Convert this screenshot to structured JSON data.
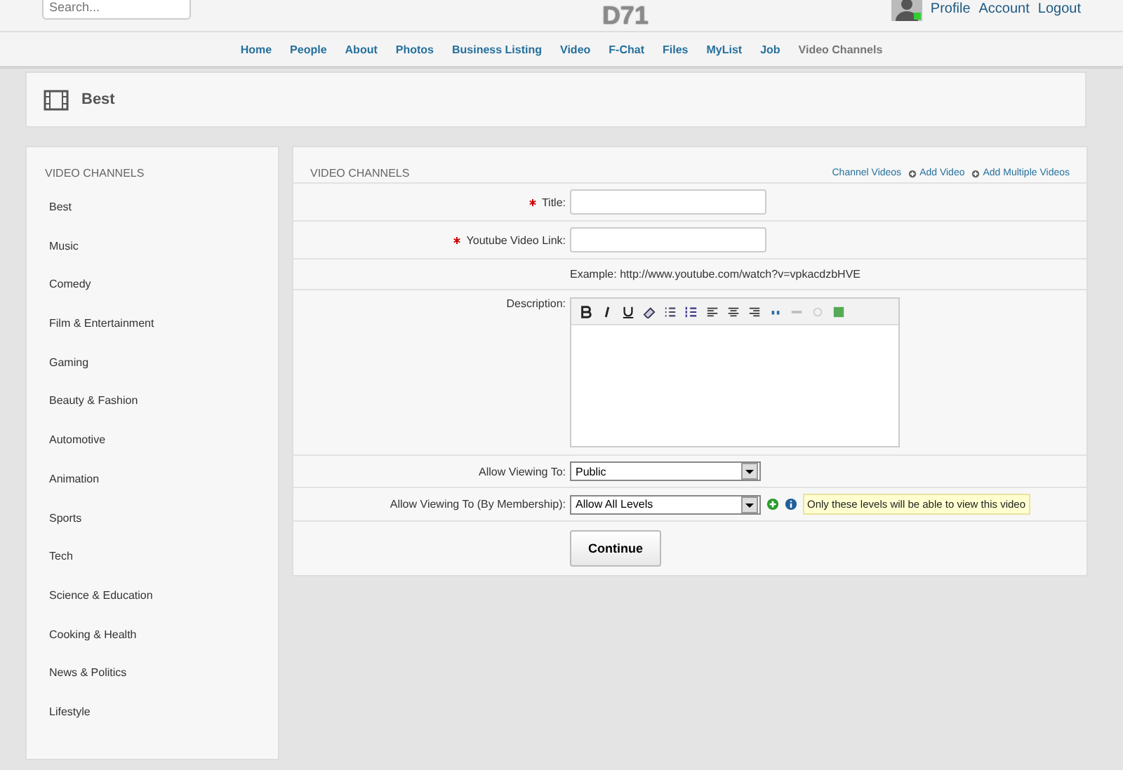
{
  "header": {
    "search": {
      "placeholder": "Search..."
    },
    "logo": "D71",
    "user_links": [
      "Profile",
      "Account",
      "Logout"
    ]
  },
  "nav": [
    {
      "label": "Home",
      "selected": false
    },
    {
      "label": "People",
      "selected": false
    },
    {
      "label": "About",
      "selected": false
    },
    {
      "label": "Photos",
      "selected": false
    },
    {
      "label": "Business Listing",
      "selected": false
    },
    {
      "label": "Video",
      "selected": false
    },
    {
      "label": "F-Chat",
      "selected": false
    },
    {
      "label": "Files",
      "selected": false
    },
    {
      "label": "MyList",
      "selected": false
    },
    {
      "label": "Job",
      "selected": false
    },
    {
      "label": "Video Channels",
      "selected": true
    }
  ],
  "page_title": "Best",
  "sidebar": {
    "title": "VIDEO CHANNELS",
    "items": [
      "Best",
      "Music",
      "Comedy",
      "Film & Entertainment",
      "Gaming",
      "Beauty & Fashion",
      "Automotive",
      "Animation",
      "Sports",
      "Tech",
      "Science & Education",
      "Cooking & Health",
      "News & Politics",
      "Lifestyle"
    ]
  },
  "form": {
    "title": "VIDEO CHANNELS",
    "links": [
      {
        "label": "Channel Videos",
        "kind": "plain"
      },
      {
        "label": "Add Video",
        "kind": "icon"
      },
      {
        "label": "Add Multiple Videos",
        "kind": "icon"
      }
    ],
    "fields": [
      {
        "kind": "text",
        "label": "Title:",
        "required": true
      },
      {
        "kind": "text",
        "label": "Youtube Video Link:",
        "required": true
      },
      {
        "kind": "note",
        "text": "Example: http://www.youtube.com/watch?v=vpkacdzbHVE"
      },
      {
        "kind": "editor",
        "label": "Description:",
        "required": false
      },
      {
        "kind": "select",
        "label": "Allow Viewing To:",
        "required": false,
        "value": "Public"
      },
      {
        "kind": "select",
        "label": "Allow Viewing To (By Membership):",
        "required": false,
        "value": "Allow All Levels",
        "tooltip": "Only these levels will be able to view this video"
      }
    ],
    "submit": "Continue"
  }
}
